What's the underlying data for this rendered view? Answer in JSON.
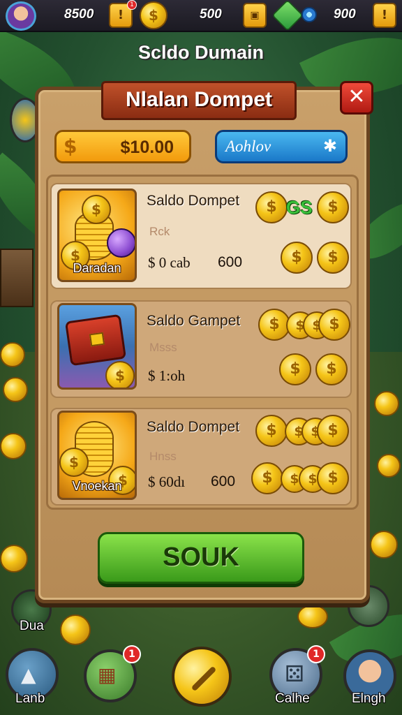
{
  "hud": {
    "stat1": "8500",
    "box1_icon": "!",
    "notification_count": "1",
    "stat2": "500",
    "stat3": "900",
    "box3_icon": "!",
    "coin_symbol": "$"
  },
  "screen_title": "Scldo Dumain",
  "dialog": {
    "title": "Nlalan Dompet",
    "close_label": "✕",
    "balance": {
      "currency": "$",
      "amount": "$10.00"
    },
    "action": {
      "label": "Aohlov",
      "icon": "✱"
    },
    "items": [
      {
        "thumb_label": "Daradan",
        "title": "Saldo Dompet",
        "subtitle": "Rck",
        "price": "$ 0 cab",
        "qty": "600",
        "badge": "GS"
      },
      {
        "thumb_label": "",
        "title": "Saldo Gampet",
        "subtitle": "Msss",
        "price": "$ 1:oh",
        "qty": "",
        "badge": ""
      },
      {
        "thumb_label": "Vnoekan",
        "title": "Saldo Dompet",
        "subtitle": "Hnss",
        "price": "$ 60dı",
        "qty": "600",
        "badge": ""
      }
    ],
    "confirm_label": "SOUK"
  },
  "side": {
    "left_label": "Dua"
  },
  "nav": {
    "item1": "Lanb",
    "item2_badge": "1",
    "item4_label": "Calhe",
    "item4_badge": "1",
    "item5": "Elngh"
  },
  "colors": {
    "panel": "#c9a06a",
    "banner": "#a83a1c",
    "close": "#d8261c",
    "balance": "#f5b020",
    "action": "#2a90dc",
    "confirm": "#5cc02a"
  }
}
